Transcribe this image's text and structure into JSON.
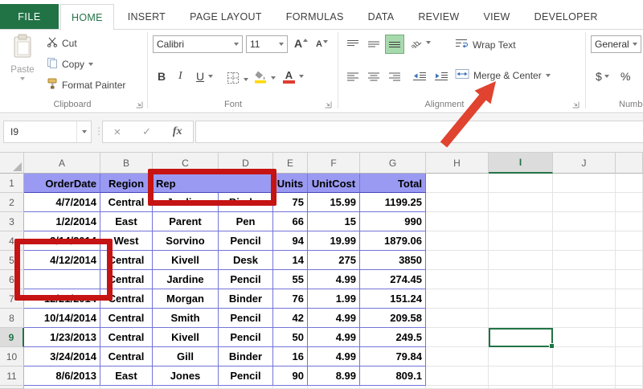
{
  "tabs": {
    "file": "FILE",
    "items": [
      "HOME",
      "INSERT",
      "PAGE LAYOUT",
      "FORMULAS",
      "DATA",
      "REVIEW",
      "VIEW",
      "DEVELOPER"
    ],
    "active": "HOME"
  },
  "ribbon": {
    "clipboard": {
      "group_label": "Clipboard",
      "paste_label": "Paste",
      "cut_label": "Cut",
      "copy_label": "Copy",
      "format_painter_label": "Format Painter"
    },
    "font": {
      "group_label": "Font",
      "font_name": "Calibri",
      "font_size": "11",
      "grow_font_label": "A",
      "shrink_font_label": "A",
      "bold_label": "B",
      "italic_label": "I",
      "underline_label": "U",
      "font_color_label": "A"
    },
    "alignment": {
      "group_label": "Alignment",
      "wrap_text_label": "Wrap Text",
      "merge_center_label": "Merge & Center",
      "active_vertical_align": "bottom"
    },
    "number": {
      "group_label": "Number",
      "format_value": "General",
      "currency_label": "$",
      "percent_label": "%"
    }
  },
  "formula_bar": {
    "name_box_value": "I9",
    "cancel_glyph": "×",
    "enter_glyph": "✓",
    "fx_label": "fx",
    "formula_value": ""
  },
  "grid": {
    "column_letters": [
      "A",
      "B",
      "C",
      "D",
      "E",
      "F",
      "G",
      "H",
      "I",
      "J"
    ],
    "header_row": {
      "order_date": "OrderDate",
      "region": "Region",
      "rep": "Rep",
      "units": "Units",
      "unit_cost": "UnitCost",
      "total": "Total"
    },
    "rows": [
      [
        "4/7/2014",
        "Central",
        "Jardine",
        "Binder",
        "75",
        "15.99",
        "1199.25"
      ],
      [
        "1/2/2014",
        "East",
        "Parent",
        "Pen",
        "66",
        "15",
        "990"
      ],
      [
        "3/14/2014",
        "West",
        "Sorvino",
        "Pencil",
        "94",
        "19.99",
        "1879.06"
      ],
      [
        "4/12/2014",
        "Central",
        "Kivell",
        "Desk",
        "14",
        "275",
        "3850"
      ],
      [
        "",
        "Central",
        "Jardine",
        "Pencil",
        "55",
        "4.99",
        "274.45"
      ],
      [
        "12/21/2014",
        "Central",
        "Morgan",
        "Binder",
        "76",
        "1.99",
        "151.24"
      ],
      [
        "10/14/2014",
        "Central",
        "Smith",
        "Pencil",
        "42",
        "4.99",
        "209.58"
      ],
      [
        "1/23/2013",
        "Central",
        "Kivell",
        "Pencil",
        "50",
        "4.99",
        "249.5"
      ],
      [
        "3/24/2014",
        "Central",
        "Gill",
        "Binder",
        "16",
        "4.99",
        "79.84"
      ],
      [
        "8/6/2013",
        "East",
        "Jones",
        "Pencil",
        "90",
        "8.99",
        "809.1"
      ]
    ],
    "selected_cell": "I9",
    "selected_column": "I",
    "selected_row": 9
  },
  "annotations": {
    "rectangle_color": "#c51413",
    "arrow_color": "#e0432f",
    "rectangle_1_target": "rep-merged-header",
    "rectangle_2_target": "orderdate-cells-a5-a6",
    "arrow_target": "merge-and-center-button"
  },
  "theme": {
    "excel_green": "#217346",
    "table_header_fill": "#9a9af2",
    "table_border": "#7373d9",
    "fill_color_swatch": "#ffd800",
    "font_color_swatch": "#e03c31"
  }
}
